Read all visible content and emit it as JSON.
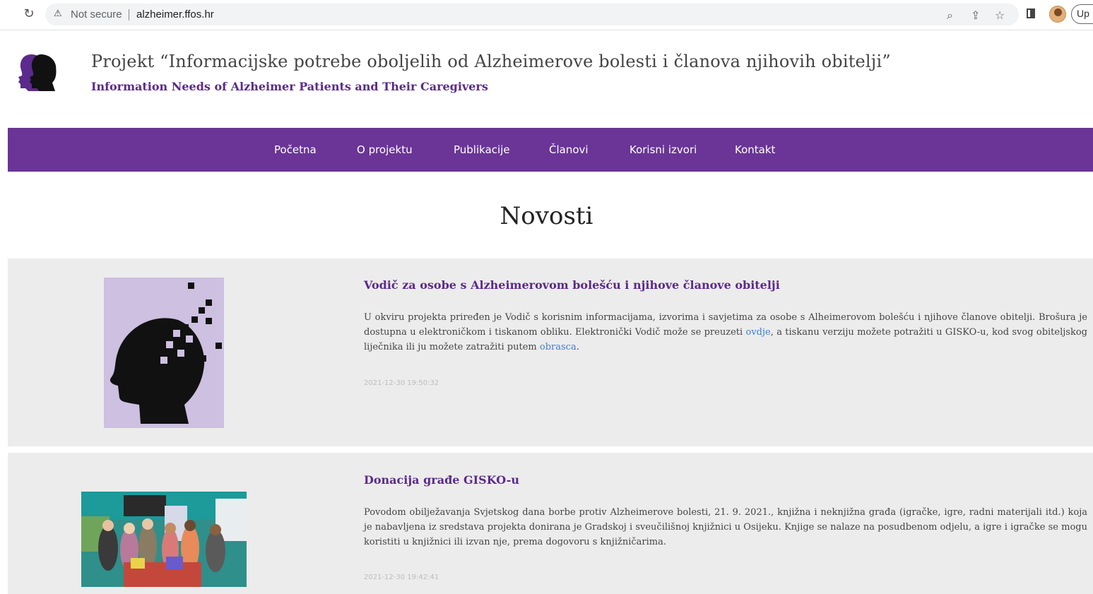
{
  "browser": {
    "security_label": "Not secure",
    "url": "alzheimer.ffos.hr",
    "update_label": "Up"
  },
  "site": {
    "title": "Projekt “Informacijske potrebe oboljelih od Alzheimerove bolesti i članova njihovih obitelji”",
    "subtitle": "Information Needs of Alzheimer Patients and Their Caregivers",
    "accent_color": "#6a3596"
  },
  "nav": {
    "items": [
      {
        "label": "Početna"
      },
      {
        "label": "O projektu"
      },
      {
        "label": "Publikacije"
      },
      {
        "label": "Članovi"
      },
      {
        "label": "Korisni izvori"
      },
      {
        "label": "Kontakt"
      }
    ]
  },
  "page": {
    "title": "Novosti"
  },
  "news": [
    {
      "title": "Vodič za osobe s Alzheimerovom bolešću i njihove članove obitelji",
      "body_part1": "U okviru projekta priređen je Vodič s korisnim informacijama, izvorima i savjetima za osobe s Alheimerovom bolešću i njihove članove obitelji. Brošura je dostupna u elektroničkom i tiskanom obliku. Elektronički Vodič može se preuzeti ",
      "link1": "ovdje",
      "body_part2": ", a tiskanu verziju možete potražiti u GISKO-u, kod svog obiteljskog liječnika ili ju možete zatražiti putem ",
      "link2": "obrasca",
      "body_part3": ".",
      "date": "2021-12-30 19:50:32"
    },
    {
      "title": "Donacija građe GISKO-u",
      "body": "Povodom obilježavanja Svjetskog dana borbe protiv Alzheimerove bolesti, 21. 9. 2021., knjižna i neknjižna građa (igračke, igre, radni materijali itd.) koja je nabavljena iz sredstava projekta donirana je Gradskoj i sveučilišnoj knjižnici u Osijeku. Knjige se nalaze na posudbenom odjelu, a igre i igračke se mogu koristiti u knjižnici ili izvan nje, prema dogovoru s knjižničarima.",
      "date": "2021-12-30 19:42:41"
    }
  ]
}
